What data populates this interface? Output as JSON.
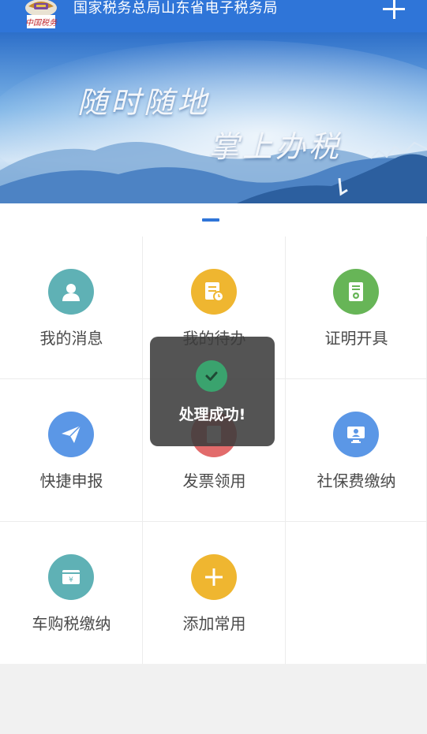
{
  "header": {
    "title": "国家税务总局山东省电子税务局",
    "logo_icon": "tax-bureau-emblem-icon",
    "add_icon": "plus-icon",
    "background_color": "#2f75d8"
  },
  "banner": {
    "line1": "随时随地",
    "line2": "掌上办税"
  },
  "pager": {
    "active_index": 0,
    "color": "#2f75d8"
  },
  "grid": {
    "items": [
      {
        "label": "我的消息",
        "icon": "user-icon",
        "color": "#5fb1b5"
      },
      {
        "label": "我的待办",
        "icon": "document-clock-icon",
        "color": "#efb630"
      },
      {
        "label": "证明开具",
        "icon": "certificate-icon",
        "color": "#67b557"
      },
      {
        "label": "快捷申报",
        "icon": "paper-plane-icon",
        "color": "#5b97e6"
      },
      {
        "label": "发票领用",
        "icon": "invoice-icon",
        "color": "#e26b6b"
      },
      {
        "label": "社保费缴纳",
        "icon": "monitor-person-icon",
        "color": "#5b97e6"
      },
      {
        "label": "车购税缴纳",
        "icon": "yuan-wallet-icon",
        "color": "#5fb1b5"
      },
      {
        "label": "添加常用",
        "icon": "plus-icon",
        "color": "#efb630"
      }
    ]
  },
  "toast": {
    "text": "处理成功!",
    "icon": "check-icon",
    "icon_color": "#3aa36e"
  }
}
